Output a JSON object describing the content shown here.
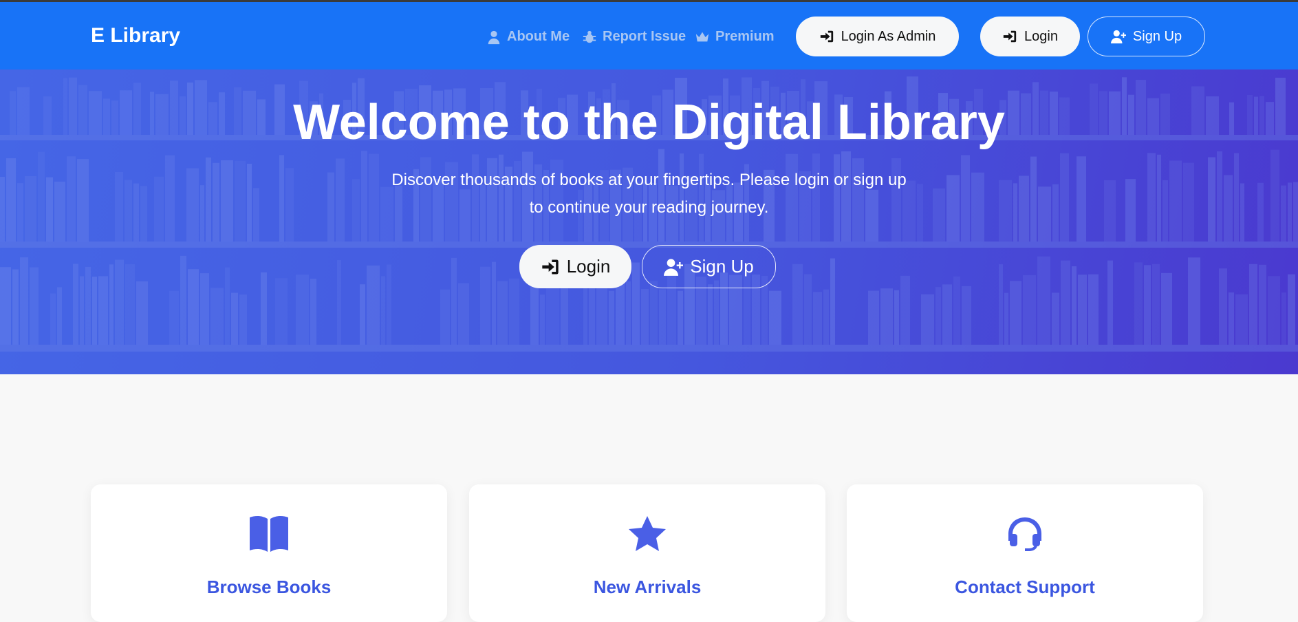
{
  "navbar": {
    "brand": "E Library",
    "links": [
      {
        "label": "About Me",
        "icon": "user-icon"
      },
      {
        "label": "Report Issue",
        "icon": "bug-icon"
      },
      {
        "label": "Premium",
        "icon": "crown-icon"
      }
    ],
    "login_admin_label": "Login As Admin",
    "login_label": "Login",
    "signup_label": "Sign Up"
  },
  "hero": {
    "title": "Welcome to the Digital Library",
    "subtitle": "Discover thousands of books at your fingertips. Please login or sign up to continue your reading journey.",
    "login_label": "Login",
    "signup_label": "Sign Up"
  },
  "features": [
    {
      "title": "Browse Books",
      "icon": "book-open-icon"
    },
    {
      "title": "New Arrivals",
      "icon": "star-icon"
    },
    {
      "title": "Contact Support",
      "icon": "headset-icon"
    }
  ],
  "colors": {
    "navbar": "#1873f7",
    "hero_start": "#4566e6",
    "hero_end": "#4a39cf",
    "accent": "#3b56e0",
    "page_bg": "#f8f8f8"
  }
}
